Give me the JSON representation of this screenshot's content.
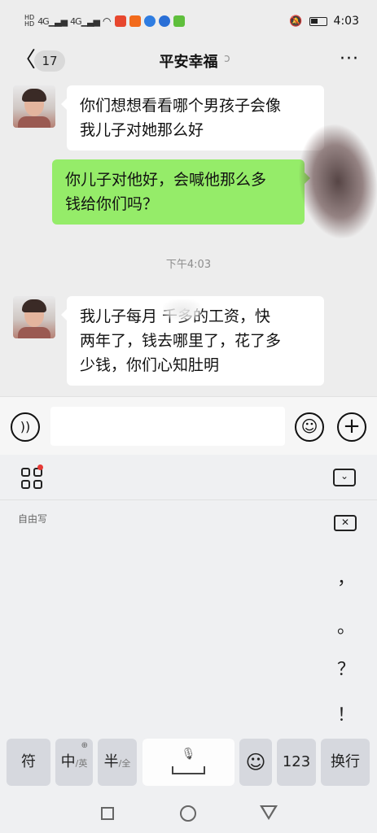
{
  "status_bar": {
    "hd_1": "HD",
    "hd_2": "HD",
    "net_1": "4G",
    "net_2": "4G",
    "time": "4:03",
    "icons": [
      "hd-icon",
      "signal-icon",
      "wifi-icon",
      "app-icon",
      "mute-icon",
      "battery-icon"
    ]
  },
  "header": {
    "back_glyph": "〈",
    "unread_count": "17",
    "title": "平安幸福",
    "ear_glyph": "ↄ",
    "more_glyph": "···"
  },
  "messages": [
    {
      "side": "in",
      "text_lines": [
        "你们想想看看哪个男孩子会像",
        "我儿子对她那么好"
      ]
    },
    {
      "side": "out",
      "text_lines": [
        "你儿子对他好，会喊他那么多",
        "钱给你们吗？"
      ]
    },
    {
      "side": "in",
      "text_lines": [
        "我儿子每月   千多的工资，快",
        "两年了，钱去哪里了，花了多",
        "少钱，你们心知肚明"
      ]
    }
  ],
  "timestamp": "下午4:03",
  "input_bar": {
    "voice_glyph": "))",
    "input_value": "",
    "emoji_glyph": "☺",
    "plus_glyph": "+"
  },
  "keyboard": {
    "collapse_glyph": "⌄",
    "hint": "自由写",
    "backspace_glyph": "✕",
    "punctuation": [
      "，",
      "。",
      "？",
      "！"
    ],
    "keys": {
      "symbol": "符",
      "zh": "中",
      "zh_sub": "/英",
      "half": "半",
      "half_sub": "/全",
      "mic_glyph": "🎙",
      "emoji": "☺",
      "num": "123",
      "enter": "换行",
      "globe_glyph": "⊕"
    }
  },
  "colors": {
    "outgoing_bubble": "#95ec69",
    "incoming_bubble": "#ffffff",
    "chat_background": "#ededed",
    "notification_dot": "#e53935"
  }
}
